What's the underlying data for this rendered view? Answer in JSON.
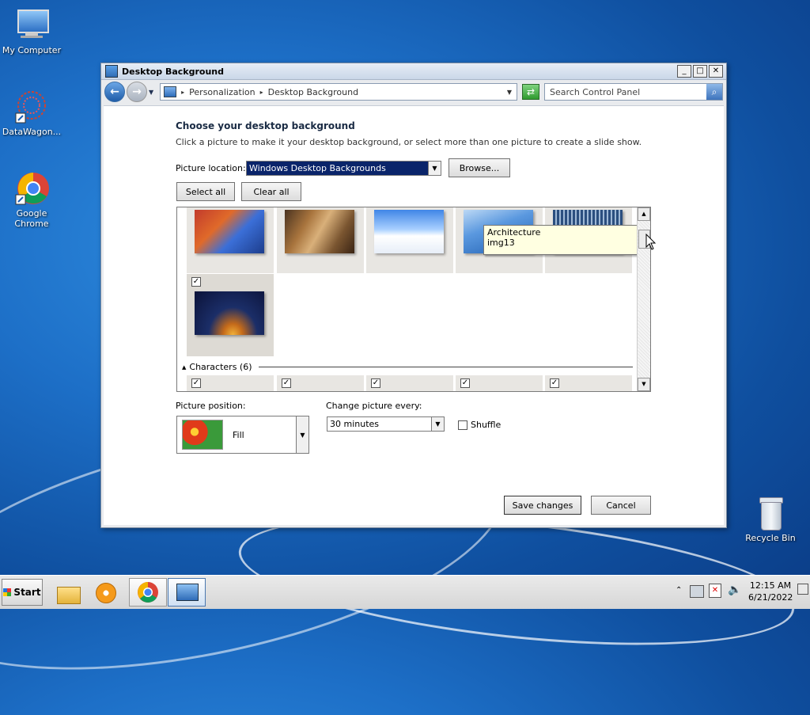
{
  "desktop": {
    "icons": [
      {
        "label": "My Computer"
      },
      {
        "label": "DataWagon..."
      },
      {
        "label": "Google Chrome"
      },
      {
        "label": "Recycle Bin"
      }
    ]
  },
  "window": {
    "title": "Desktop Background",
    "controls": {
      "minimize": "_",
      "maximize": "□",
      "close": "✕"
    },
    "breadcrumb": [
      "Personalization",
      "Desktop Background"
    ],
    "search_placeholder": "Search Control Panel",
    "heading": "Choose your desktop background",
    "subheading": "Click a picture to make it your desktop background, or select more than one picture to create a slide show.",
    "picture_location_label": "Picture location:",
    "picture_location_value": "Windows Desktop Backgrounds",
    "browse_label": "Browse...",
    "select_all_label": "Select all",
    "clear_all_label": "Clear all",
    "tooltip": {
      "line1": "Architecture",
      "line2": "img13"
    },
    "group_header": "Characters (6)",
    "picture_position_label": "Picture position:",
    "picture_position_value": "Fill",
    "change_every_label": "Change picture every:",
    "change_every_value": "30 minutes",
    "shuffle_label": "Shuffle",
    "save_label": "Save changes",
    "cancel_label": "Cancel"
  },
  "taskbar": {
    "start_label": "Start",
    "time": "12:15 AM",
    "date": "6/21/2022"
  },
  "colors": {
    "accent": "#1a5fb4",
    "selection": "#0a246a"
  }
}
